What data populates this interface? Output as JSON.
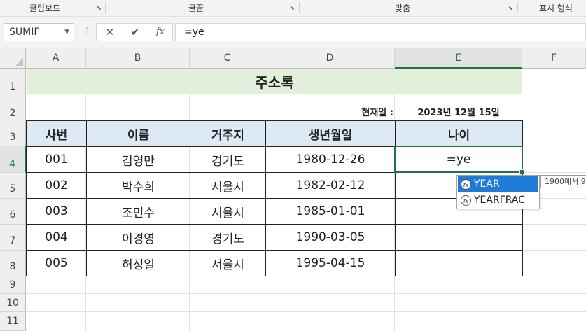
{
  "ribbon": {
    "groups": [
      "클립보드",
      "글꼴",
      "맞춤",
      "표시 형식"
    ]
  },
  "formula_bar": {
    "name_box": "SUMIF",
    "cancel_icon": "✕",
    "enter_icon": "✔",
    "fx_label": "fx",
    "formula": "=ye"
  },
  "columns": [
    "A",
    "B",
    "C",
    "D",
    "E",
    "F"
  ],
  "rows": [
    "1",
    "2",
    "3",
    "4",
    "5",
    "6",
    "7",
    "8",
    "9",
    "10",
    "11"
  ],
  "sheet": {
    "title": "주소록",
    "date_label": "현재일 :",
    "date_value": "2023년 12월 15일",
    "headers": [
      "사번",
      "이름",
      "거주지",
      "생년월일",
      "나이"
    ],
    "records": [
      [
        "001",
        "김영만",
        "경기도",
        "1980-12-26"
      ],
      [
        "002",
        "박수희",
        "서울시",
        "1982-02-12"
      ],
      [
        "003",
        "조민수",
        "서울시",
        "1985-01-01"
      ],
      [
        "004",
        "이경영",
        "경기도",
        "1990-03-05"
      ],
      [
        "005",
        "허정일",
        "서울시",
        "1995-04-15"
      ]
    ],
    "active_cell_text": "=ye"
  },
  "autocomplete": {
    "items": [
      "YEAR",
      "YEARFRAC"
    ],
    "tooltip": "1900에서 9"
  },
  "colors": {
    "accent": "#217346",
    "selection": "#1f7cd6",
    "title_fill": "#e2efdb",
    "header_fill": "#dde9f5"
  }
}
